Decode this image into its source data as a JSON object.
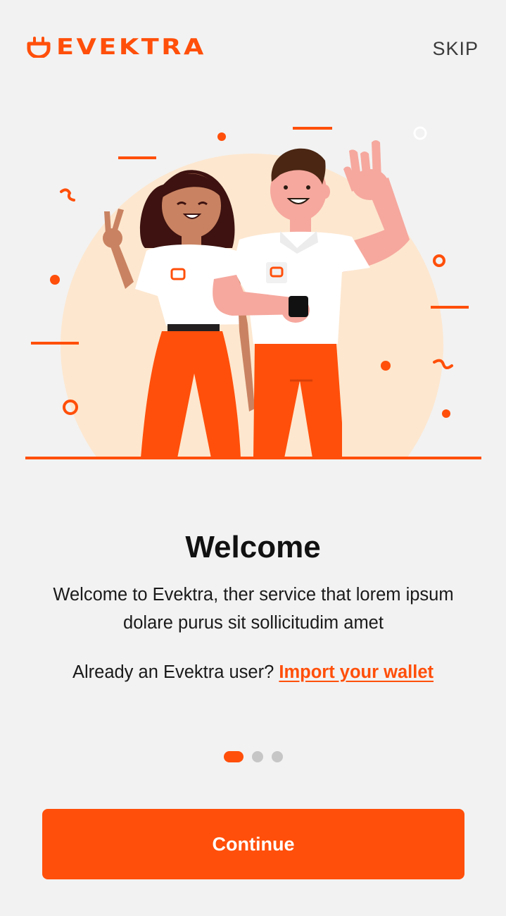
{
  "app": {
    "brand_name": "EVEKTRA",
    "accent_color": "#ff4f0a",
    "logo_icon": "plug-icon"
  },
  "header": {
    "skip_label": "SKIP"
  },
  "illustration": {
    "subject": "two-people-waving"
  },
  "content": {
    "title": "Welcome",
    "description": "Welcome to Evektra, ther service that lorem ipsum dolare purus sit sollicitudim amet",
    "import_prompt": "Already an Evektra user?",
    "import_link": "Import your wallet"
  },
  "pagination": {
    "total": 3,
    "current": 1
  },
  "actions": {
    "continue_label": "Continue"
  }
}
